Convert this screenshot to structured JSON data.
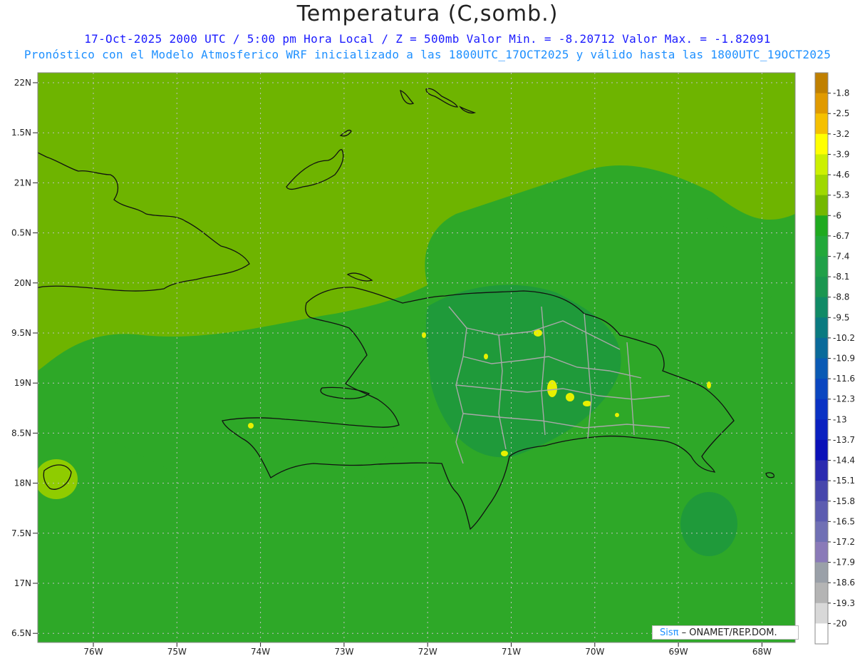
{
  "title": "Temperatura (C,somb.)",
  "subtitle_line1": "17-Oct-2025  2000 UTC / 5:00 pm Hora Local / Z = 500mb  Valor Min. = -8.20712  Valor Max. = -1.82091",
  "subtitle_line2": "Pronóstico con el Modelo Atmosferico WRF inicializado a las 1800UTC_17OCT2025 y válido hasta las  1800UTC_19OCT2025",
  "credit_brand": "Sisπ",
  "credit_text": " – ONAMET/REP.DOM.",
  "lat_ticks": [
    "22N",
    "1.5N",
    "21N",
    "0.5N",
    "20N",
    "9.5N",
    "19N",
    "8.5N",
    "18N",
    "7.5N",
    "17N",
    "6.5N"
  ],
  "lon_ticks": [
    "76W",
    "75W",
    "74W",
    "73W",
    "72W",
    "71W",
    "70W",
    "69W",
    "68W"
  ],
  "colorbar": {
    "labels": [
      "-1.8",
      "-2.5",
      "-3.2",
      "-3.9",
      "-4.6",
      "-5.3",
      "-6",
      "-6.7",
      "-7.4",
      "-8.1",
      "-8.8",
      "-9.5",
      "-10.2",
      "-10.9",
      "-11.6",
      "-12.3",
      "-13",
      "-13.7",
      "-14.4",
      "-15.1",
      "-15.8",
      "-16.5",
      "-17.2",
      "-17.9",
      "-18.6",
      "-19.3",
      "-20"
    ],
    "colors": [
      "#c08000",
      "#e09a00",
      "#f5c000",
      "#ffff00",
      "#ccf000",
      "#9fd800",
      "#74b800",
      "#1faa1f",
      "#22a83a",
      "#20a048",
      "#1a9650",
      "#108a66",
      "#0a7a80",
      "#0a6a9a",
      "#0a5ab4",
      "#0a46c0",
      "#0a32c4",
      "#0a20c0",
      "#0a10b8",
      "#2a2ab0",
      "#4646ac",
      "#5c5cb0",
      "#7070b4",
      "#8a7ab8",
      "#9aa0a8",
      "#b4b4b4",
      "#d8d8d8",
      "#ffffff"
    ]
  },
  "palette": {
    "field_base": "#6eb400",
    "field_light": "#8fcc00",
    "field_green": "#2ea828",
    "field_dark": "#1f9a3a",
    "hot": "#e8f000",
    "coast": "#111111",
    "borders": "#a8a8a8"
  }
}
